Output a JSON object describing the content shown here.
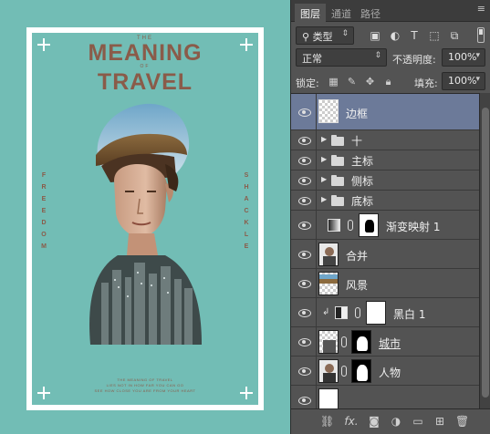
{
  "poster": {
    "title_small_top": "THE",
    "title_line1": "MEANING",
    "title_small_mid": "OF",
    "title_line2": "TRAVEL",
    "left_vertical": "FREEDOM",
    "right_vertical": "SHACKLE",
    "bottom_line1": "THE MEANING OF TRAVEL",
    "bottom_line2": "LIES NOT IN HOW FAR YOU CAN GO",
    "bottom_line3": "SEE HOW CLOSE YOU ARE FROM YOUR HEART",
    "colors": {
      "background": "#72bdb5",
      "frame": "#ffffff",
      "text": "#8a5b49"
    }
  },
  "panel": {
    "tabs": [
      {
        "label": "图层",
        "active": true
      },
      {
        "label": "通道",
        "active": false
      },
      {
        "label": "路径",
        "active": false
      }
    ],
    "filter_label": "类型",
    "blend_mode": "正常",
    "opacity_label": "不透明度:",
    "opacity_value": "100%",
    "lock_label": "锁定:",
    "fill_label": "填充:",
    "fill_value": "100%",
    "layers": [
      {
        "name": "边框",
        "kind": "pixel",
        "selected": true
      },
      {
        "name": "十",
        "kind": "group"
      },
      {
        "name": "主标",
        "kind": "group"
      },
      {
        "name": "侧标",
        "kind": "group"
      },
      {
        "name": "底标",
        "kind": "group"
      },
      {
        "name": "渐变映射 1",
        "kind": "adjustment-gradient"
      },
      {
        "name": "合并",
        "kind": "pixel"
      },
      {
        "name": "风景",
        "kind": "pixel"
      },
      {
        "name": "黑白 1",
        "kind": "adjustment-bw",
        "clipped": true
      },
      {
        "name": "城市",
        "kind": "masked"
      },
      {
        "name": "人物",
        "kind": "masked"
      }
    ],
    "bottom_icons": [
      "link-icon",
      "fx-icon",
      "mask-icon",
      "adjustment-icon",
      "folder-icon",
      "new-layer-icon",
      "trash-icon"
    ],
    "bottom_fx_label": "fx.",
    "colors": {
      "panel": "#535353",
      "selected_row": "#6c7a99"
    }
  }
}
